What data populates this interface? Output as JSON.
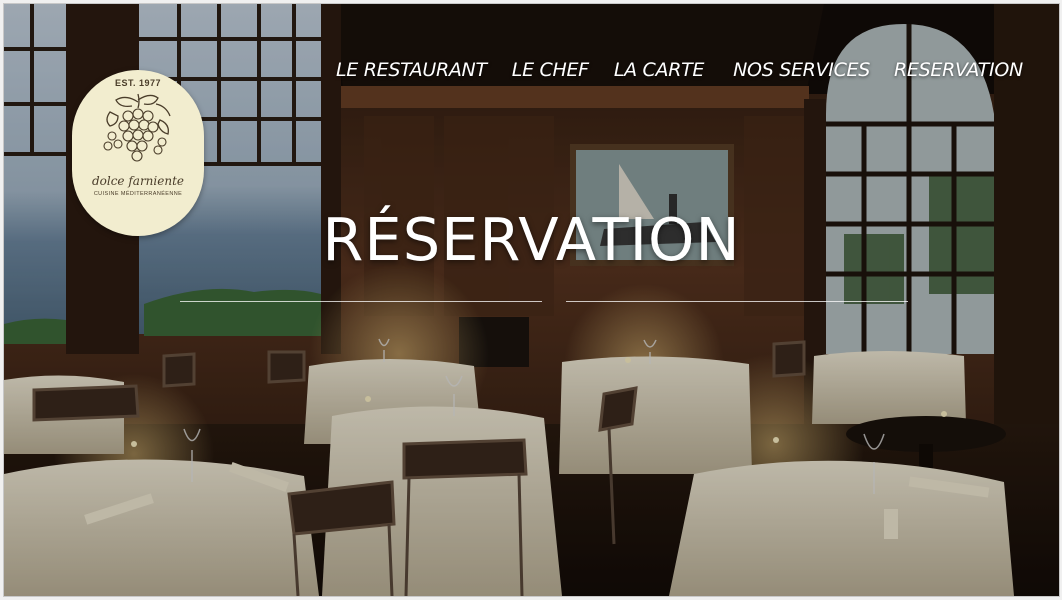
{
  "nav": {
    "items": [
      {
        "label": "LE RESTAURANT"
      },
      {
        "label": "LE CHEF"
      },
      {
        "label": "LA CARTE"
      },
      {
        "label": "NOS SERVICES"
      },
      {
        "label": "RESERVATION"
      }
    ]
  },
  "logo": {
    "est": "EST. 1977",
    "name": "dolce farniente",
    "tagline": "CUISINE MÉDITERRANÉENNE",
    "icon": "grapes-icon"
  },
  "hero": {
    "title": "RÉSERVATION"
  },
  "colors": {
    "nav_text": "#ffffff",
    "logo_bg": "#f2edcf",
    "logo_ink": "#4a3d2a",
    "wood": "#3a2414"
  }
}
